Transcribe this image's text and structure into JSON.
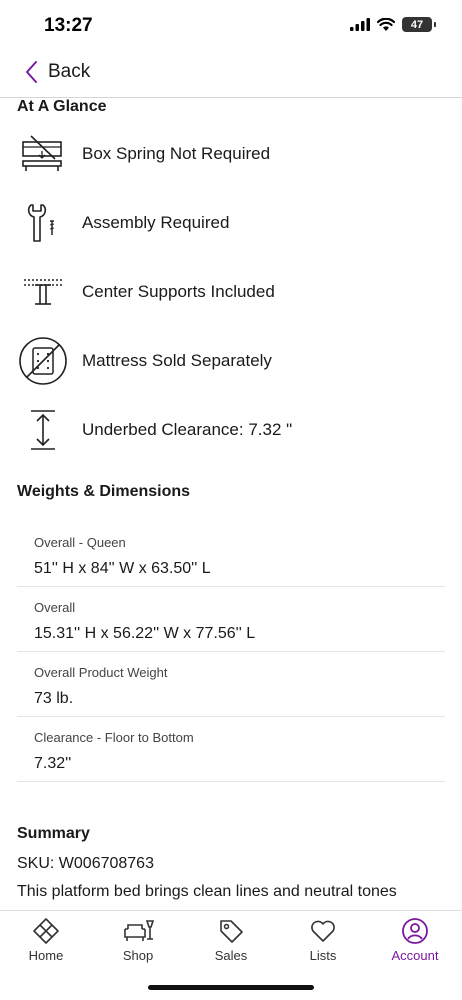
{
  "status_bar": {
    "time": "13:27",
    "battery": "47"
  },
  "nav": {
    "back_label": "Back"
  },
  "glance": {
    "title": "At A Glance",
    "items": [
      {
        "icon": "box-spring-crossed-icon",
        "label": "Box Spring Not Required"
      },
      {
        "icon": "wrench-screw-icon",
        "label": "Assembly Required"
      },
      {
        "icon": "center-support-icon",
        "label": "Center Supports Included"
      },
      {
        "icon": "mattress-crossed-icon",
        "label": "Mattress Sold Separately"
      },
      {
        "icon": "vertical-arrow-icon",
        "label": "Underbed Clearance: 7.32 \""
      }
    ]
  },
  "dimensions": {
    "title": "Weights & Dimensions",
    "rows": [
      {
        "label": "Overall - Queen",
        "value": "51'' H x 84'' W x 63.50'' L"
      },
      {
        "label": "Overall",
        "value": "15.31'' H x 56.22'' W x 77.56'' L"
      },
      {
        "label": "Overall Product Weight",
        "value": "73 lb."
      },
      {
        "label": "Clearance - Floor to Bottom",
        "value": "7.32''"
      }
    ]
  },
  "summary": {
    "title": "Summary",
    "sku": "SKU: W006708763",
    "text": "This platform bed brings clean lines and neutral tones"
  },
  "tabs": [
    {
      "label": "Home",
      "icon": "home-icon",
      "active": false
    },
    {
      "label": "Shop",
      "icon": "shop-icon",
      "active": false
    },
    {
      "label": "Sales",
      "icon": "sales-tag-icon",
      "active": false
    },
    {
      "label": "Lists",
      "icon": "heart-icon",
      "active": false
    },
    {
      "label": "Account",
      "icon": "account-icon",
      "active": true
    }
  ],
  "colors": {
    "accent": "#7b189f",
    "text": "#1a1a1a",
    "divider": "#e4e4e4"
  }
}
